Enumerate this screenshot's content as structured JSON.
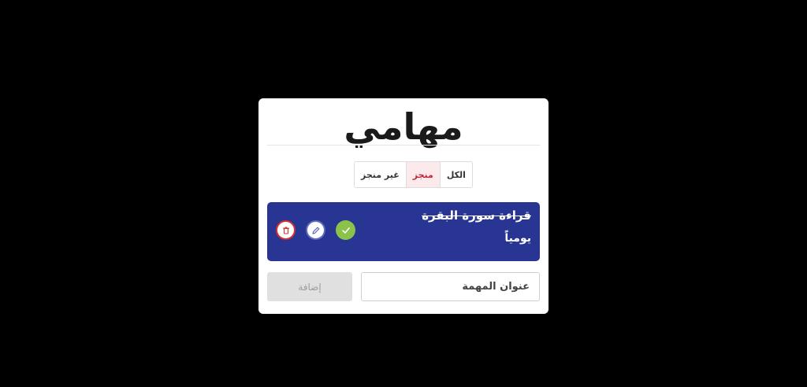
{
  "app": {
    "title": "مهامي"
  },
  "filters": [
    {
      "label": "الكل",
      "active": false
    },
    {
      "label": "منجز",
      "active": true
    },
    {
      "label": "غير منجز",
      "active": false
    }
  ],
  "task": {
    "title": "قراءة سورة البقرة",
    "subtitle": "يومياً",
    "color": "#283593",
    "actions": [
      "check-icon",
      "pencil-icon",
      "trash-icon"
    ]
  },
  "add_form": {
    "placeholder": "عنوان المهمة",
    "button_label": "إضافة"
  }
}
